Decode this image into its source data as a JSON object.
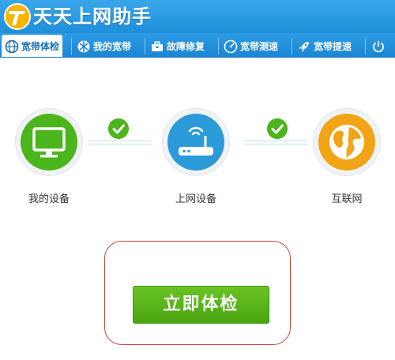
{
  "app": {
    "title": "天天上网助手"
  },
  "tabs": [
    {
      "label": "宽带体检",
      "icon": "globe-icon",
      "active": true
    },
    {
      "label": "我的宽带",
      "icon": "network-icon",
      "active": false
    },
    {
      "label": "故障修复",
      "icon": "toolbox-icon",
      "active": false
    },
    {
      "label": "宽带测速",
      "icon": "speedometer-icon",
      "active": false
    },
    {
      "label": "宽带提速",
      "icon": "rocket-icon",
      "active": false
    },
    {
      "label": "",
      "icon": "power-icon",
      "active": false
    }
  ],
  "flow": {
    "nodes": [
      {
        "label": "我的设备",
        "icon": "monitor-icon",
        "color": "#4bb51c"
      },
      {
        "label": "上网设备",
        "icon": "router-icon",
        "color": "#2b9ad8"
      },
      {
        "label": "互联网",
        "icon": "earth-icon",
        "color": "#f1a415"
      }
    ],
    "links": [
      {
        "status": "ok"
      },
      {
        "status": "ok"
      }
    ]
  },
  "action": {
    "start_label": "立即体检"
  },
  "colors": {
    "brand": "#2196e0",
    "success": "#4bb51c",
    "accent": "#f1a415",
    "frame": "#c7463a"
  }
}
